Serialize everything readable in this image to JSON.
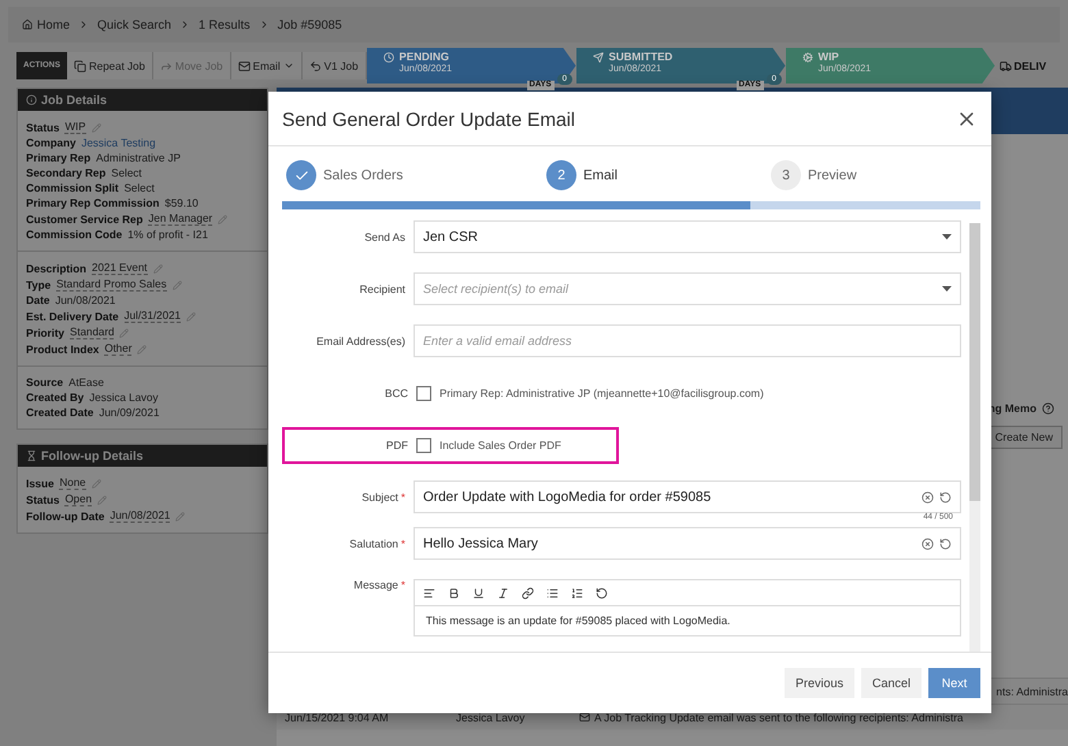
{
  "breadcrumb": [
    "Home",
    "Quick Search",
    "1 Results",
    "Job #59085"
  ],
  "toolbar": {
    "label": "ACTIONS",
    "buttons": [
      {
        "label": "Repeat Job",
        "disabled": false,
        "has_menu": false
      },
      {
        "label": "Move Job",
        "disabled": true,
        "has_menu": false
      },
      {
        "label": "Email",
        "disabled": false,
        "has_menu": true
      },
      {
        "label": "V1 Job",
        "disabled": false,
        "has_menu": false
      }
    ]
  },
  "pipeline": [
    {
      "kind": "stage",
      "label": "PENDING",
      "date": "Jun/08/2021",
      "color": "#2e5b86",
      "days": {
        "label": "DAYS",
        "count": "0"
      }
    },
    {
      "kind": "stage",
      "label": "SUBMITTED",
      "date": "Jun/08/2021",
      "color": "#2f6070",
      "days": {
        "label": "DAYS",
        "count": "0"
      }
    },
    {
      "kind": "stage",
      "label": "WIP",
      "date": "Jun/08/2021",
      "color": "#3e7a66"
    },
    {
      "kind": "next",
      "label": "DELIV"
    }
  ],
  "job_details": {
    "title": "Job Details",
    "groups": [
      [
        {
          "label": "Status",
          "value": "WIP",
          "editable": true,
          "link": false
        },
        {
          "label": "Company",
          "value": "Jessica Testing",
          "editable": false,
          "link": true
        },
        {
          "label": "Primary Rep",
          "value": "Administrative JP",
          "editable": false,
          "link": false
        },
        {
          "label": "Secondary Rep",
          "value": "Select",
          "editable": false,
          "link": false
        },
        {
          "label": "Commission Split",
          "value": "Select",
          "editable": false,
          "link": false
        },
        {
          "label": "Primary Rep Commission",
          "value": "$59.10",
          "editable": false,
          "link": false
        },
        {
          "label": "Customer Service Rep",
          "value": "Jen Manager",
          "editable": true,
          "link": false
        },
        {
          "label": "Commission Code",
          "value": "1% of profit - I21",
          "editable": false,
          "link": false
        }
      ],
      [
        {
          "label": "Description",
          "value": "2021 Event",
          "editable": true,
          "link": false
        },
        {
          "label": "Type",
          "value": "Standard Promo Sales",
          "editable": true,
          "link": false
        },
        {
          "label": "Date",
          "value": "Jun/08/2021",
          "editable": false,
          "link": false
        },
        {
          "label": "Est. Delivery Date",
          "value": "Jul/31/2021",
          "editable": true,
          "link": false
        },
        {
          "label": "Priority",
          "value": "Standard",
          "editable": true,
          "link": false
        },
        {
          "label": "Product Index",
          "value": "Other",
          "editable": true,
          "link": false
        }
      ],
      [
        {
          "label": "Source",
          "value": "AtEase",
          "editable": false,
          "link": false
        },
        {
          "label": "Created By",
          "value": "Jessica Lavoy",
          "editable": false,
          "link": false
        },
        {
          "label": "Created Date",
          "value": "Jun/09/2021",
          "editable": false,
          "link": false
        }
      ]
    ]
  },
  "followup_details": {
    "title": "Follow-up Details",
    "rows": [
      {
        "label": "Issue",
        "value": "None",
        "editable": true,
        "link": false
      },
      {
        "label": "Status",
        "value": "Open",
        "editable": true,
        "link": false
      },
      {
        "label": "Follow-up Date",
        "value": "Jun/08/2021",
        "editable": true,
        "link": false
      }
    ]
  },
  "memo": {
    "title": "ng Memo",
    "button": "Create New"
  },
  "log_rows": [
    {
      "message": "nts: Administra"
    },
    {
      "date": "Jun/15/2021 9:04 AM",
      "user": "Jessica Lavoy",
      "message": "A Job Tracking Update email was sent to the following recipients: Administra"
    }
  ],
  "modal": {
    "title": "Send General Order Update Email",
    "steps": [
      {
        "label": "Sales Orders",
        "done": true,
        "selected": false
      },
      {
        "number": "2",
        "label": "Email",
        "done": false,
        "selected": true
      },
      {
        "number": "3",
        "label": "Preview",
        "done": false,
        "selected": false
      }
    ],
    "progress": {
      "level": 0.67
    },
    "fields": [
      {
        "kind": "select",
        "label": "Send As",
        "value": "Jen CSR"
      },
      {
        "kind": "select",
        "label": "Recipient",
        "placeholder": "Select recipient(s) to email"
      },
      {
        "kind": "input",
        "label": "Email Address(es)",
        "placeholder": "Enter a valid email address"
      },
      {
        "kind": "checkbox",
        "label": "BCC",
        "text": "Primary Rep: Administrative JP (mjeannette+10@facilisgroup.com)",
        "checked": false,
        "highlighted": false
      },
      {
        "kind": "checkbox",
        "label": "PDF",
        "text": "Include Sales Order PDF",
        "checked": false,
        "highlighted": true
      },
      {
        "kind": "text",
        "label": "Subject",
        "required_mark": "*",
        "value": "Order Update with LogoMedia for order #59085",
        "counter": "44 / 500"
      },
      {
        "kind": "text",
        "label": "Salutation",
        "required_mark": "*",
        "value": "Hello Jessica Mary"
      },
      {
        "kind": "editor",
        "label": "Message",
        "required_mark": "*",
        "value": "This message is an update for #59085 placed with LogoMedia."
      }
    ],
    "buttons": [
      {
        "label": "Previous",
        "kind": "secondary"
      },
      {
        "label": "Cancel",
        "kind": "secondary"
      },
      {
        "label": "Next",
        "kind": "primary"
      }
    ]
  }
}
